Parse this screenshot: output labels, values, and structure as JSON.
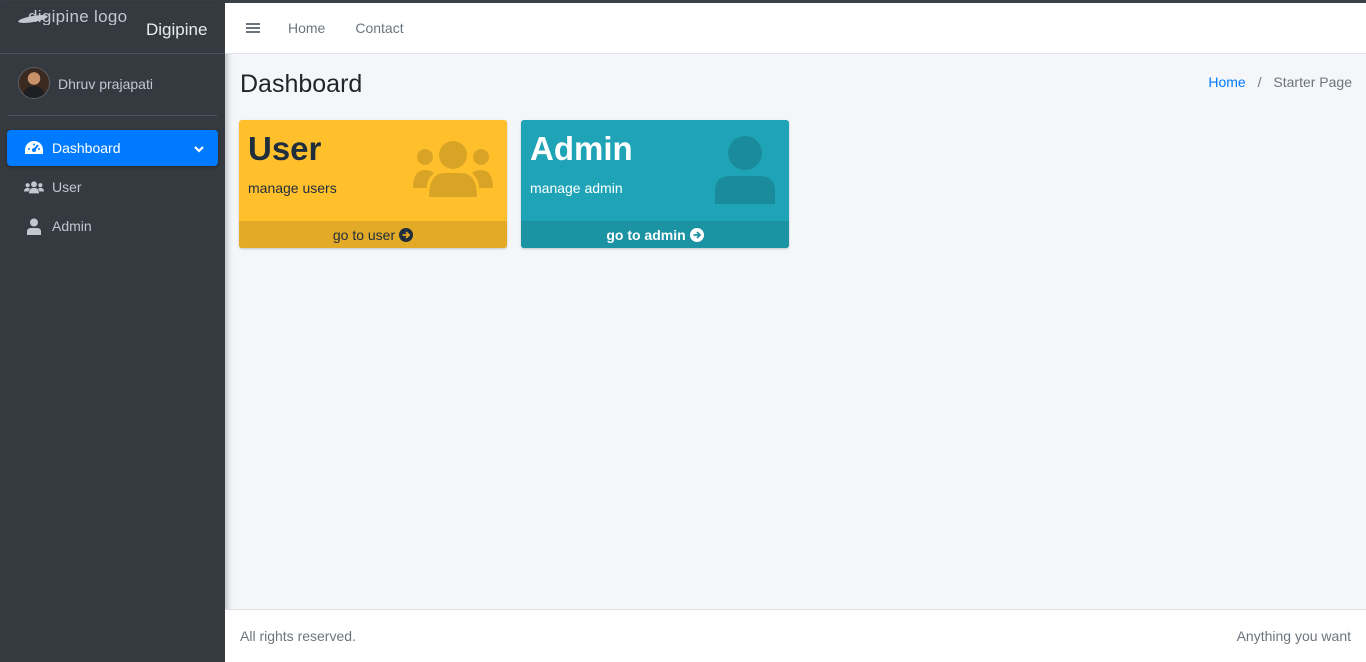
{
  "brand": {
    "logo_alt": "digipine logo",
    "name": "Digipine"
  },
  "user_panel": {
    "name": "Dhruv prajapati"
  },
  "sidebar": {
    "items": [
      {
        "label": "Dashboard",
        "icon": "tachometer-icon",
        "active": true
      },
      {
        "label": "User",
        "icon": "users-icon",
        "active": false
      },
      {
        "label": "Admin",
        "icon": "user-icon",
        "active": false
      }
    ]
  },
  "navbar": {
    "links": [
      "Home",
      "Contact"
    ]
  },
  "page": {
    "title": "Dashboard",
    "breadcrumb": {
      "home": "Home",
      "current": "Starter Page"
    }
  },
  "cards": [
    {
      "title": "User",
      "subtitle": "manage users",
      "footer": "go to user",
      "color": "#ffc02c"
    },
    {
      "title": "Admin",
      "subtitle": "manage admin",
      "footer": "go to admin",
      "color": "#1ea4b6"
    }
  ],
  "footer": {
    "left": "All rights reserved.",
    "right": "Anything you want"
  },
  "colors": {
    "sidebar_bg": "#343a40",
    "accent": "#007bff",
    "warning": "#ffc02c",
    "info": "#1ea4b6"
  }
}
